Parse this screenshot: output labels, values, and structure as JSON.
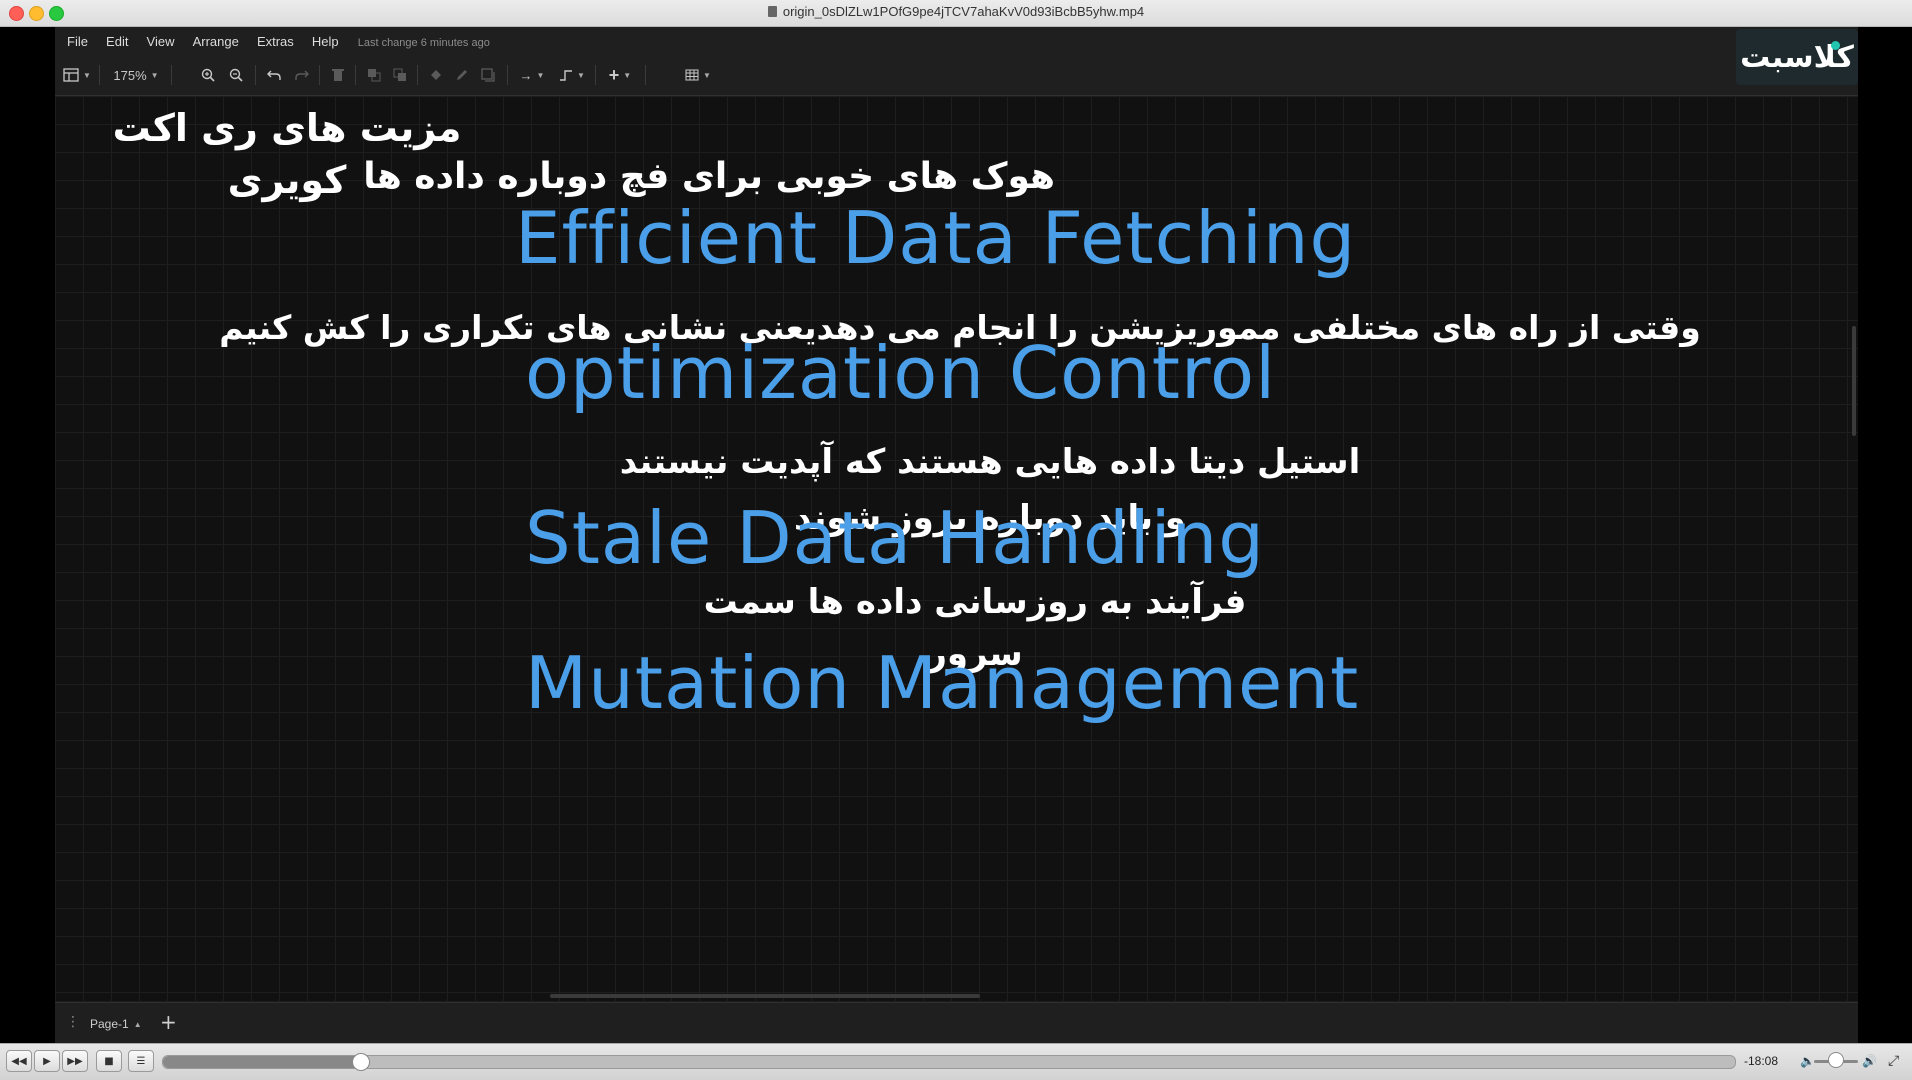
{
  "window": {
    "title": "origin_0sDlZLw1POfG9pe4jTCV7ahaKvV0d93iBcbB5yhw.mp4"
  },
  "menubar": {
    "items": [
      "File",
      "Edit",
      "View",
      "Arrange",
      "Extras",
      "Help"
    ],
    "last_change": "Last change 6 minutes ago"
  },
  "toolbar": {
    "zoom": "175%"
  },
  "logo": {
    "text": "کلاسبت",
    "accent_color": "#22c6b0"
  },
  "canvas": {
    "title_fa_line1": "مزیت های ری اکت",
    "title_fa_line2": "کویری",
    "items": [
      {
        "fa_lines": [
          "هوک های خوبی برای فچ دوباره داده ها"
        ],
        "en": "Efficient Data Fetching"
      },
      {
        "fa_lines": [
          "وقتی از راه های مختلفی مموریزیشن را انجام می دهدیعنی نشانی های تکراری را کش کنیم"
        ],
        "en": "optimization Control"
      },
      {
        "fa_lines": [
          "استیل دیتا داده هایی هستند که آپدیت نیستند",
          "و باید دوباره بروز شوند"
        ],
        "en": "Stale Data Handling"
      },
      {
        "fa_lines": [
          "فرآیند به روزسانی داده ها سمت",
          "سرور"
        ],
        "en": "Mutation Management"
      }
    ],
    "text_color_fa": "#ffffff",
    "text_color_en": "#4a9fe8"
  },
  "pagebar": {
    "page_label": "Page-1"
  },
  "player": {
    "time_remaining": "-18:08",
    "progress_fraction": 0.125
  }
}
